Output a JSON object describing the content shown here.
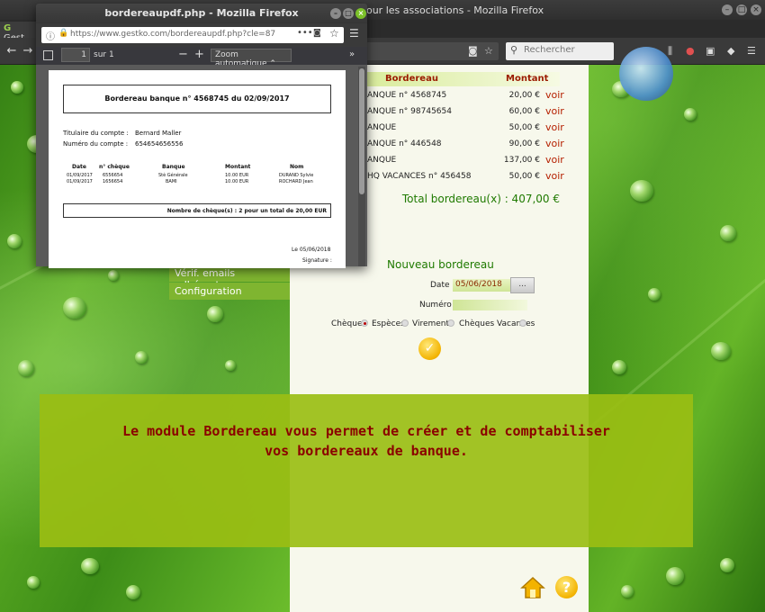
{
  "main_window": {
    "title": "pour les associations - Mozilla Firefox",
    "tab_label": "Gest",
    "search_placeholder": "Rechercher"
  },
  "popup": {
    "title": "bordereaupdf.php - Mozilla Firefox",
    "url": "https://www.gestko.com/bordereaupdf.php?cle=87",
    "page_number": "1",
    "page_of": "sur 1",
    "zoom": "Zoom automatique",
    "pdf": {
      "heading": "Bordereau banque n° 4568745 du 02/09/2017",
      "holder_label": "Titulaire du compte :",
      "holder_value": "Bernard Maller",
      "account_label": "Numéro du compte :",
      "account_value": "654654656556",
      "columns": [
        "Date",
        "n° chèque",
        "Banque",
        "Montant",
        "Nom"
      ],
      "rows": [
        [
          "01/09/2017",
          "6556654",
          "Stè Générale",
          "10.00 EUR",
          "DURAND Sylvie"
        ],
        [
          "01/09/2017",
          "1656654",
          "BAMI",
          "10.00 EUR",
          "ROCHARD Jean"
        ]
      ],
      "total": "Nombre de chèque(s) : 2 pour un total de 20,00 EUR",
      "date": "Le 05/06/2018",
      "signature": "Signature :"
    }
  },
  "menu": {
    "items": [
      "Vérif. emails adhérents",
      "Configuration"
    ]
  },
  "table": {
    "head_bordereau": "Bordereau",
    "head_montant": "Montant",
    "voir_label": "voir",
    "rows": [
      {
        "desc": "ANQUE n° 4568745",
        "amount": "20,00 €"
      },
      {
        "desc": "ANQUE n° 98745654",
        "amount": "60,00 €"
      },
      {
        "desc": "ANQUE",
        "amount": "50,00 €"
      },
      {
        "desc": "ANQUE n° 446548",
        "amount": "90,00 €"
      },
      {
        "desc": "ANQUE",
        "amount": "137,00 €"
      },
      {
        "desc": "HQ VACANCES n° 456458",
        "amount": "50,00 €"
      }
    ],
    "total": "Total bordereau(x) : 407,00 €"
  },
  "form": {
    "title": "Nouveau bordereau",
    "date_label": "Date :",
    "date_value": "05/06/2018",
    "date_button": "...",
    "numero_label": "Numéro :",
    "types": [
      "Chèques",
      "Espèces",
      "Virements",
      "Chèques Vacances"
    ],
    "selected_type": "Chèques"
  },
  "banner": {
    "line1": "Le module Bordereau vous permet de créer et de comptabiliser",
    "line2": "vos bordereaux de banque."
  },
  "colors": {
    "accent_green": "#7fb530",
    "voir_red": "#b52000",
    "banner_bg": "#9abe14",
    "banner_text": "#8a0000"
  }
}
